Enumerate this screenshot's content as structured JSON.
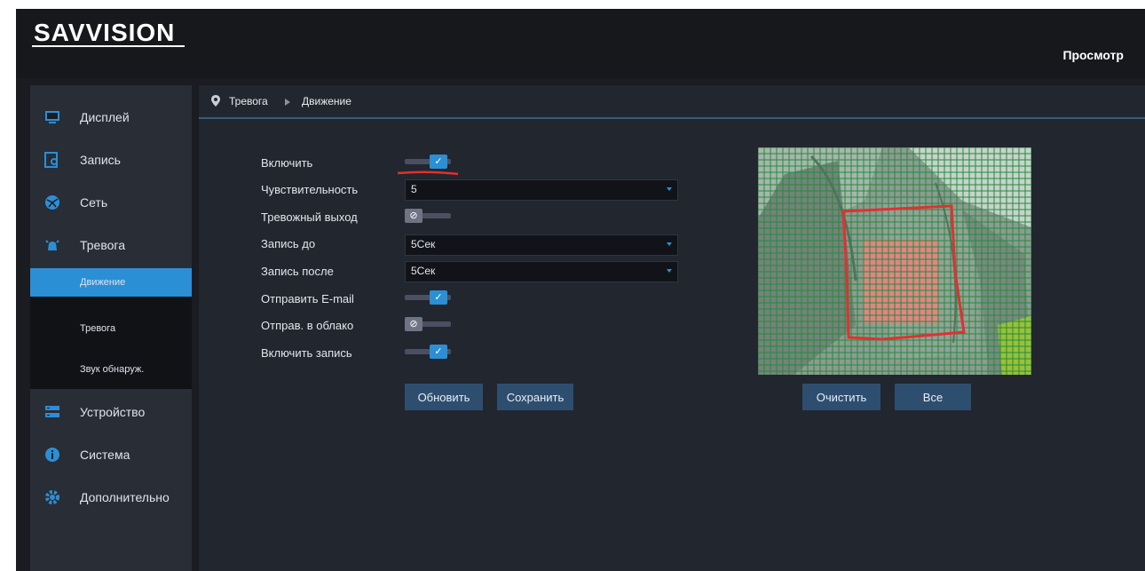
{
  "header": {
    "logo_text": "SAVVISION",
    "view_label": "Просмотр"
  },
  "sidebar": {
    "items": [
      {
        "label": "Дисплей",
        "icon": "monitor-icon"
      },
      {
        "label": "Запись",
        "icon": "record-search-icon"
      },
      {
        "label": "Сеть",
        "icon": "network-globe-icon"
      },
      {
        "label": "Тревога",
        "icon": "alarm-bell-icon"
      }
    ],
    "sub_items": [
      {
        "label": "Движение",
        "active": true
      },
      {
        "label": "Тревога",
        "active": false
      },
      {
        "label": "Звук обнаруж.",
        "active": false
      }
    ],
    "items_after": [
      {
        "label": "Устройство",
        "icon": "device-icon"
      },
      {
        "label": "Система",
        "icon": "info-icon"
      },
      {
        "label": "Дополнительно",
        "icon": "gear-icon"
      }
    ]
  },
  "breadcrumb": {
    "items": [
      "Тревога",
      "Движение"
    ]
  },
  "form": {
    "enable": {
      "label": "Включить",
      "on": true
    },
    "sensitivity": {
      "label": "Чувствительность",
      "value": "5"
    },
    "alarm_output": {
      "label": "Тревожный выход",
      "on": false
    },
    "record_before": {
      "label": "Запись до",
      "value": "5Сек"
    },
    "record_after": {
      "label": "Запись после",
      "value": "5Сек"
    },
    "send_email": {
      "label": "Отправить E-mail",
      "on": true
    },
    "send_cloud": {
      "label": "Отправ. в облако",
      "on": false
    },
    "enable_record": {
      "label": "Включить запись",
      "on": true
    }
  },
  "buttons": {
    "refresh": "Обновить",
    "save": "Сохранить",
    "clear": "Очистить",
    "all": "Все"
  },
  "colors": {
    "accent": "#2b8fd6",
    "annotation": "#e03131",
    "grid": "#1f8f3a",
    "region_fill": "#f08080"
  }
}
